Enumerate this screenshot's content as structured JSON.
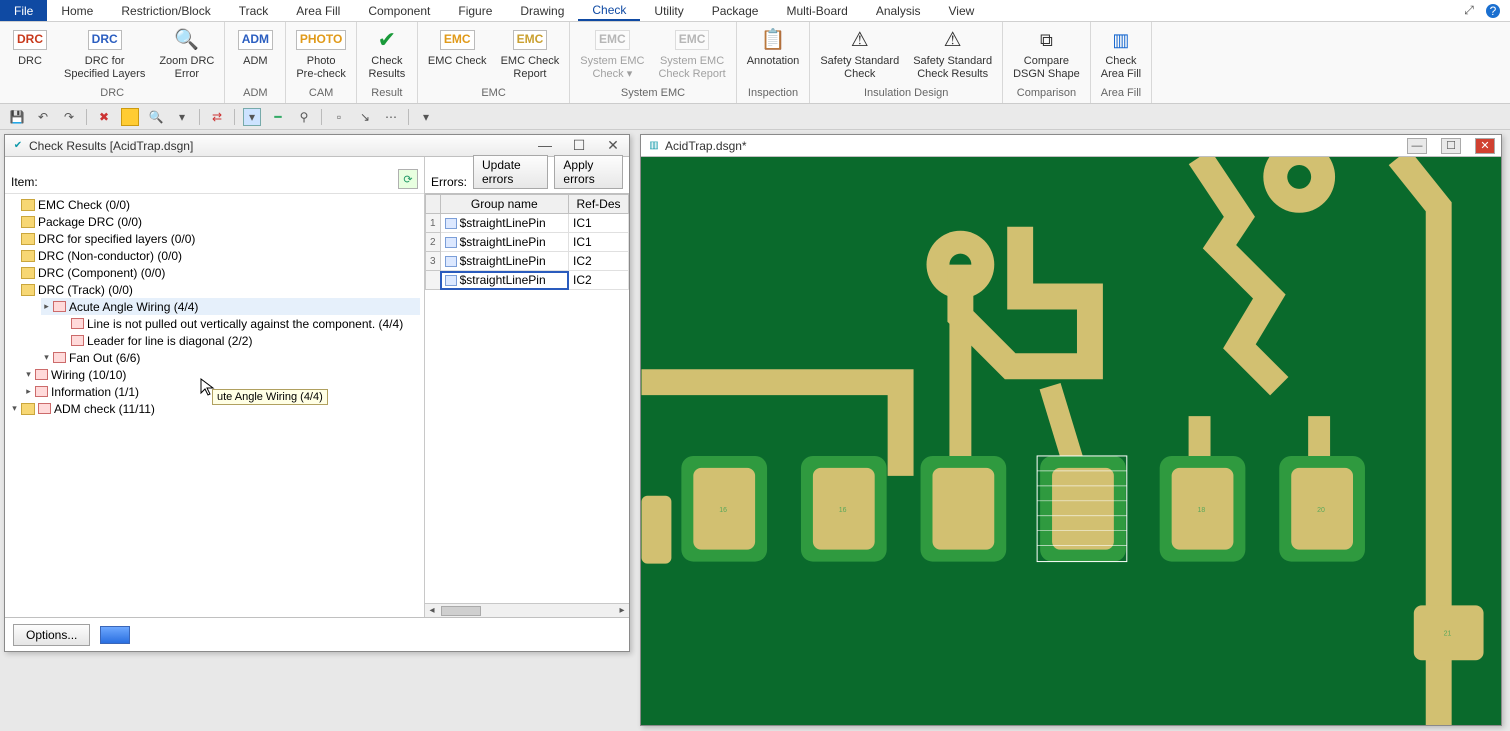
{
  "menubar": {
    "items": [
      "File",
      "Home",
      "Restriction/Block",
      "Track",
      "Area Fill",
      "Component",
      "Figure",
      "Drawing",
      "Check",
      "Utility",
      "Package",
      "Multi-Board",
      "Analysis",
      "View"
    ],
    "active": "Check"
  },
  "ribbon": {
    "groups": [
      {
        "label": "DRC",
        "buttons": [
          {
            "label": "DRC",
            "icon": "DRC",
            "color": "#c83a1d"
          },
          {
            "label": "DRC for\nSpecified Layers",
            "icon": "DRC",
            "color": "#2b5ec0"
          },
          {
            "label": "Zoom DRC\nError",
            "icon": "zoom"
          }
        ]
      },
      {
        "label": "ADM",
        "buttons": [
          {
            "label": "ADM",
            "icon": "ADM",
            "color": "#2b5ec0"
          }
        ]
      },
      {
        "label": "CAM",
        "buttons": [
          {
            "label": "Photo\nPre-check",
            "icon": "PHOTO",
            "color": "#e09a1a"
          }
        ]
      },
      {
        "label": "Result",
        "buttons": [
          {
            "label": "Check\nResults",
            "icon": "check"
          }
        ]
      },
      {
        "label": "EMC",
        "buttons": [
          {
            "label": "EMC Check",
            "icon": "EMC",
            "color": "#e09a1a"
          },
          {
            "label": "EMC Check\nReport",
            "icon": "EMC",
            "color": "#caa030"
          }
        ]
      },
      {
        "label": "System EMC",
        "buttons": [
          {
            "label": "System EMC\nCheck ▾",
            "icon": "EMC",
            "faded": true
          },
          {
            "label": "System EMC\nCheck Report",
            "icon": "EMC",
            "faded": true
          }
        ]
      },
      {
        "label": "Inspection",
        "buttons": [
          {
            "label": "Annotation",
            "icon": "annotation"
          }
        ]
      },
      {
        "label": "Insulation Design",
        "buttons": [
          {
            "label": "Safety Standard\nCheck",
            "icon": "safety"
          },
          {
            "label": "Safety Standard\nCheck Results",
            "icon": "safety-res"
          }
        ]
      },
      {
        "label": "Comparison",
        "buttons": [
          {
            "label": "Compare\nDSGN Shape",
            "icon": "compare"
          }
        ]
      },
      {
        "label": "Area Fill",
        "buttons": [
          {
            "label": "Check\nArea Fill",
            "icon": "areafill"
          }
        ]
      }
    ]
  },
  "check_results": {
    "title": "Check Results [AcidTrap.dsgn]",
    "item_label": "Item:",
    "errors_label": "Errors:",
    "update_btn": "Update errors",
    "apply_btn": "Apply errors",
    "tree": [
      {
        "ind": 0,
        "tw": "▾",
        "type": "folder-err",
        "text": "ADM check (11/11)"
      },
      {
        "ind": 1,
        "tw": "▸",
        "type": "err",
        "text": "Information (1/1)"
      },
      {
        "ind": 1,
        "tw": "▾",
        "type": "err",
        "text": "Wiring (10/10)"
      },
      {
        "ind": 2,
        "tw": "▾",
        "type": "err",
        "text": "Fan Out (6/6)"
      },
      {
        "ind": 3,
        "tw": "",
        "type": "err",
        "text": "Leader for line is diagonal (2/2)"
      },
      {
        "ind": 3,
        "tw": "",
        "type": "err",
        "text": "Line is not pulled out vertically against the component. (4/4)"
      },
      {
        "ind": 2,
        "tw": "▸",
        "type": "err",
        "text": "Acute Angle Wiring (4/4)",
        "selected": true
      },
      {
        "ind": 0,
        "tw": "",
        "type": "folder",
        "text": "DRC (Track) (0/0)"
      },
      {
        "ind": 0,
        "tw": "",
        "type": "folder",
        "text": "DRC (Component) (0/0)"
      },
      {
        "ind": 0,
        "tw": "",
        "type": "folder",
        "text": "DRC (Non-conductor) (0/0)"
      },
      {
        "ind": 0,
        "tw": "",
        "type": "folder",
        "text": "DRC for specified layers (0/0)"
      },
      {
        "ind": 0,
        "tw": "",
        "type": "folder",
        "text": "Package DRC (0/0)"
      },
      {
        "ind": 0,
        "tw": "",
        "type": "folder",
        "text": "EMC Check (0/0)"
      }
    ],
    "tooltip": "ute Angle Wiring (4/4)",
    "grid": {
      "headers": [
        "Group name",
        "Ref-Des"
      ],
      "rows": [
        {
          "idx": "1",
          "group": "$straightLinePin",
          "ref": "IC1"
        },
        {
          "idx": "2",
          "group": "$straightLinePin",
          "ref": "IC1"
        },
        {
          "idx": "3",
          "group": "$straightLinePin",
          "ref": "IC2"
        },
        {
          "idx": "",
          "group": "$straightLinePin",
          "ref": "IC2",
          "sel": true
        }
      ]
    },
    "options_btn": "Options..."
  },
  "canvas": {
    "title": "AcidTrap.dsgn*",
    "pad_labels": [
      "16",
      "16",
      "",
      "",
      "18",
      "20",
      "21"
    ]
  }
}
